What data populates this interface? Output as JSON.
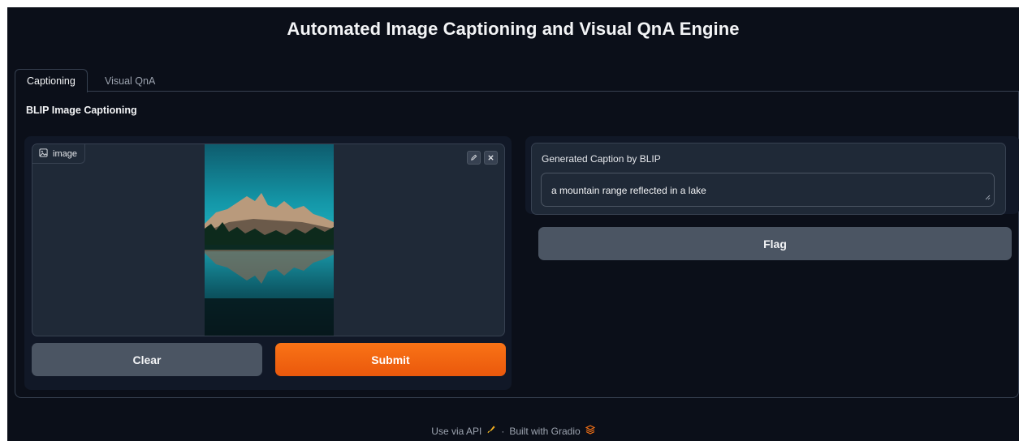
{
  "app": {
    "title": "Automated Image Captioning and Visual QnA Engine"
  },
  "tabs": [
    {
      "label": "Captioning",
      "active": true
    },
    {
      "label": "Visual QnA",
      "active": false
    }
  ],
  "section": {
    "label": "BLIP Image Captioning"
  },
  "image_input": {
    "label": "image",
    "label_icon": "image-icon",
    "edit_icon": "pencil-icon",
    "clear_icon": "close-icon"
  },
  "buttons": {
    "clear": "Clear",
    "submit": "Submit",
    "flag": "Flag"
  },
  "output": {
    "label": "Generated Caption by BLIP",
    "value": "a mountain range reflected in a lake"
  },
  "footer": {
    "api_link": "Use via API",
    "separator": "·",
    "built_with": "Built with Gradio"
  },
  "colors": {
    "background": "#0b0f19",
    "panel": "#111827",
    "block": "#1f2937",
    "border": "#374151",
    "secondary_button": "#4b5563",
    "primary_button": "#f97316"
  }
}
